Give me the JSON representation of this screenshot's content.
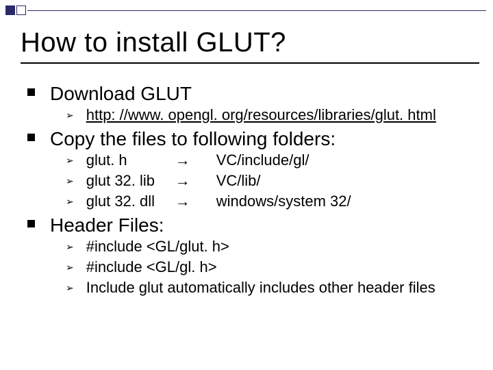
{
  "title": "How to install GLUT?",
  "sections": [
    {
      "heading": "Download GLUT",
      "items": [
        {
          "text": "http: //www. opengl. org/resources/libraries/glut. html",
          "underline": true
        }
      ]
    },
    {
      "heading": "Copy the files to following folders:",
      "items": [
        {
          "file": "glut. h",
          "arrow": "→",
          "dest": "VC/include/gl/"
        },
        {
          "file": "glut 32. lib",
          "arrow": "→",
          "dest": "VC/lib/"
        },
        {
          "file": "glut 32. dll",
          "arrow": "→",
          "dest": "windows/system 32/"
        }
      ]
    },
    {
      "heading": "Header Files:",
      "items": [
        {
          "text": "#include <GL/glut. h>"
        },
        {
          "text": "#include <GL/gl. h>"
        },
        {
          "text": " Include glut automatically includes other header files"
        }
      ]
    }
  ]
}
